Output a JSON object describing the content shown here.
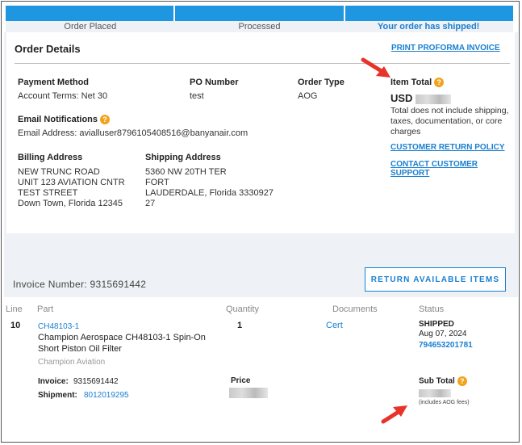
{
  "progress": {
    "step1": "Order Placed",
    "step2": "Processed",
    "step3": "Your order has shipped!"
  },
  "order": {
    "title": "Order Details",
    "print_link": "PRINT PROFORMA INVOICE",
    "payment_method_label": "Payment Method",
    "payment_method_value": "Account Terms: Net 30",
    "po_number_label": "PO Number",
    "po_number_value": "test",
    "order_type_label": "Order Type",
    "order_type_value": "AOG",
    "item_total_label": "Item Total",
    "item_total_currency": "USD",
    "item_total_note": "Total does not include shipping, taxes, documentation, or core charges",
    "return_policy_link": "CUSTOMER RETURN POLICY",
    "contact_support_link": "CONTACT CUSTOMER SUPPORT",
    "email_label": "Email Notifications",
    "email_value": "Email Address:  avialluser8796105408516@banyanair.com",
    "billing_label": "Billing Address",
    "billing_lines": [
      "NEW TRUNC ROAD",
      "UNIT 123 AVIATION CNTR",
      "TEST STREET",
      "Down Town, Florida 12345"
    ],
    "shipping_label": "Shipping Address",
    "shipping_lines": [
      "5360 NW 20TH TER",
      "FORT",
      "LAUDERDALE, Florida 3330927",
      "27"
    ]
  },
  "invoice": {
    "number_text": "Invoice Number: 9315691442",
    "return_button": "RETURN AVAILABLE ITEMS"
  },
  "table": {
    "headers": [
      "Line",
      "Part",
      "Quantity",
      "Documents",
      "Status"
    ],
    "row": {
      "line": "10",
      "part_number": "CH48103-1",
      "part_desc_1": "Champion Aerospace CH48103-1 Spin-On",
      "part_desc_2": "Short Piston Oil Filter",
      "manufacturer": "Champion Aviation",
      "quantity": "1",
      "document": "Cert",
      "status": "SHIPPED",
      "status_date": "Aug 07, 2024",
      "tracking": "794653201781",
      "invoice_label": "Invoice:",
      "invoice_value": "9315691442",
      "shipment_label": "Shipment:",
      "shipment_value": "8012019295",
      "price_label": "Price",
      "subtotal_label": "Sub Total",
      "aog_note": "(includes AOG fees)"
    }
  },
  "colors": {
    "accent": "#1a7fd0",
    "progress": "#1e96e0",
    "help": "#f2a31c",
    "arrow": "#e8332a"
  }
}
